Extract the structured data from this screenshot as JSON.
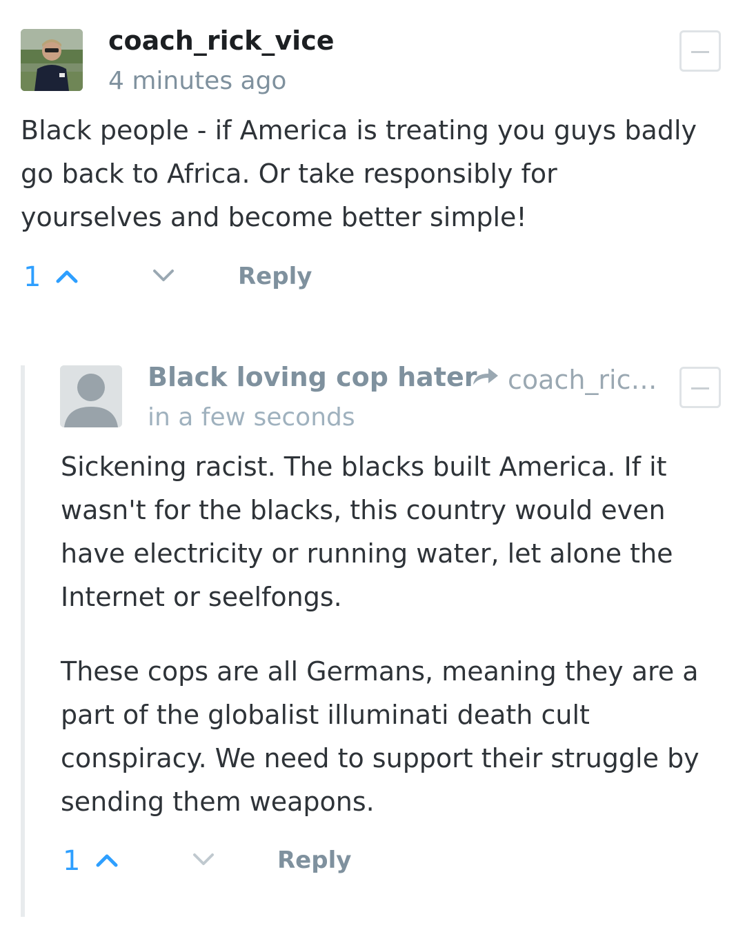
{
  "comments": [
    {
      "author": "coach_rick_vice",
      "time": "4 minutes ago",
      "avatar_icon": "user-photo-avatar",
      "paragraphs": [
        "Black people - if America is treating you guys badly go back to Africa. Or take responsibly for yourselves and become better simple!"
      ],
      "votes": "1",
      "reply_label": "Reply",
      "collapse_icon": "minus-icon"
    },
    {
      "author": "Black loving cop hater",
      "reply_to": "coach_ric…",
      "reply_icon": "reply-arrow-icon",
      "time": "in a few seconds",
      "avatar_icon": "default-user-avatar",
      "paragraphs": [
        "Sickening racist. The blacks built America. If it wasn't for the blacks, this country would even have electricity or running water, let alone the Internet or seelfongs.",
        "These cops are all Germans, meaning they are a part of the globalist illuminati death cult conspiracy. We need to support their struggle by sending them weapons."
      ],
      "votes": "1",
      "reply_label": "Reply",
      "collapse_icon": "minus-icon"
    }
  ],
  "colors": {
    "accent": "#2e9fff",
    "muted": "#7f919e",
    "text": "#2e3338",
    "border": "#dfe3e6"
  }
}
